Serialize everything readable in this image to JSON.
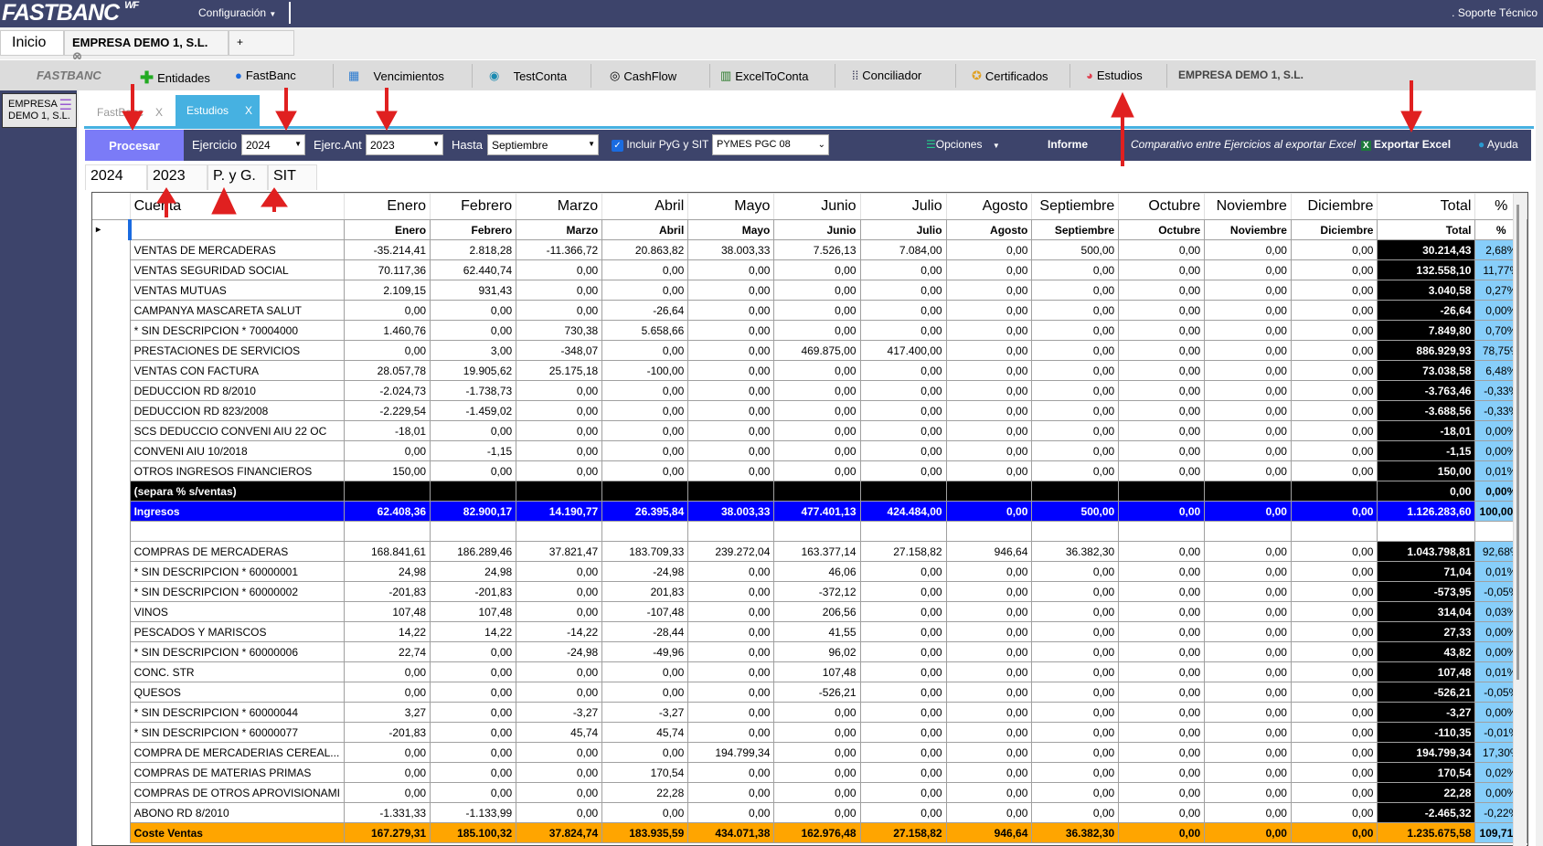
{
  "topbar": {
    "logo": "FASTBANC",
    "logo_sup": "WF",
    "config": "Configuración",
    "soporte": ". Soporte Técnico"
  },
  "tabs": {
    "inicio": "Inicio",
    "empresa": "EMPRESA DEMO 1, S.L.",
    "plus": "+"
  },
  "toolbar": {
    "brand": "FASTBANC",
    "items": [
      "Entidades",
      "FastBanc",
      "Vencimientos",
      "TestConta",
      "CashFlow",
      "ExcelToConta",
      "Conciliador",
      "Certificados",
      "Estudios"
    ],
    "company": "EMPRESA DEMO 1, S.L."
  },
  "side": {
    "company": "EMPRESA DEMO 1, S.L."
  },
  "subtabs": [
    {
      "label": "FastBanc",
      "close": "X"
    },
    {
      "label": "Estudios",
      "close": "X"
    }
  ],
  "filters": {
    "procesar": "Procesar",
    "ejercicio_label": "Ejercicio",
    "ejercicio": "2024",
    "ejerc_ant_label": "Ejerc.Ant",
    "ejerc_ant": "2023",
    "hasta_label": "Hasta",
    "hasta": "Septiembre",
    "incluir": "Incluir PyG y SIT",
    "incluir_checked": true,
    "plan": "PYMES PGC 08",
    "opciones": "Opciones",
    "informe": "Informe",
    "comparativo": "Comparativo entre Ejercicios al exportar Excel",
    "exportar": "Exportar Excel",
    "ayuda": "Ayuda"
  },
  "yeartabs": [
    "2024",
    "2023",
    "P. y G.",
    "SIT"
  ],
  "colors": {
    "header": "#3d446b",
    "accent": "#46b1e1",
    "procesar": "#7b7bf7",
    "ingresos": "#0000ff",
    "coste": "#ffa500",
    "pct": "#87cefa",
    "annotation_arrow": "#e02020"
  },
  "table": {
    "headers": [
      "Cuenta",
      "Enero",
      "Febrero",
      "Marzo",
      "Abril",
      "Mayo",
      "Junio",
      "Julio",
      "Agosto",
      "Septiembre",
      "Octubre",
      "Noviembre",
      "Diciembre",
      "Total",
      "%"
    ],
    "subheaders": [
      "",
      "Enero",
      "Febrero",
      "Marzo",
      "Abril",
      "Mayo",
      "Junio",
      "Julio",
      "Agosto",
      "Septiembre",
      "Octubre",
      "Noviembre",
      "Diciembre",
      "Total",
      "%"
    ],
    "rows": [
      {
        "type": "normal",
        "cells": [
          "VENTAS DE MERCADERAS",
          "-35.214,41",
          "2.818,28",
          "-11.366,72",
          "20.863,82",
          "38.003,33",
          "7.526,13",
          "7.084,00",
          "0,00",
          "500,00",
          "0,00",
          "0,00",
          "0,00",
          "30.214,43",
          "2,68%"
        ]
      },
      {
        "type": "normal",
        "cells": [
          "VENTAS SEGURIDAD SOCIAL",
          "70.117,36",
          "62.440,74",
          "0,00",
          "0,00",
          "0,00",
          "0,00",
          "0,00",
          "0,00",
          "0,00",
          "0,00",
          "0,00",
          "0,00",
          "132.558,10",
          "11,77%"
        ]
      },
      {
        "type": "normal",
        "cells": [
          "VENTAS MUTUAS",
          "2.109,15",
          "931,43",
          "0,00",
          "0,00",
          "0,00",
          "0,00",
          "0,00",
          "0,00",
          "0,00",
          "0,00",
          "0,00",
          "0,00",
          "3.040,58",
          "0,27%"
        ]
      },
      {
        "type": "normal",
        "cells": [
          "CAMPANYA MASCARETA SALUT",
          "0,00",
          "0,00",
          "0,00",
          "-26,64",
          "0,00",
          "0,00",
          "0,00",
          "0,00",
          "0,00",
          "0,00",
          "0,00",
          "0,00",
          "-26,64",
          "0,00%"
        ]
      },
      {
        "type": "normal",
        "cells": [
          "* SIN DESCRIPCION *  70004000",
          "1.460,76",
          "0,00",
          "730,38",
          "5.658,66",
          "0,00",
          "0,00",
          "0,00",
          "0,00",
          "0,00",
          "0,00",
          "0,00",
          "0,00",
          "7.849,80",
          "0,70%"
        ]
      },
      {
        "type": "normal",
        "cells": [
          "PRESTACIONES DE SERVICIOS",
          "0,00",
          "3,00",
          "-348,07",
          "0,00",
          "0,00",
          "469.875,00",
          "417.400,00",
          "0,00",
          "0,00",
          "0,00",
          "0,00",
          "0,00",
          "886.929,93",
          "78,75%"
        ]
      },
      {
        "type": "normal",
        "cells": [
          "VENTAS CON FACTURA",
          "28.057,78",
          "19.905,62",
          "25.175,18",
          "-100,00",
          "0,00",
          "0,00",
          "0,00",
          "0,00",
          "0,00",
          "0,00",
          "0,00",
          "0,00",
          "73.038,58",
          "6,48%"
        ]
      },
      {
        "type": "normal",
        "cells": [
          "DEDUCCION RD 8/2010",
          "-2.024,73",
          "-1.738,73",
          "0,00",
          "0,00",
          "0,00",
          "0,00",
          "0,00",
          "0,00",
          "0,00",
          "0,00",
          "0,00",
          "0,00",
          "-3.763,46",
          "-0,33%"
        ]
      },
      {
        "type": "normal",
        "cells": [
          "DEDUCCION RD 823/2008",
          "-2.229,54",
          "-1.459,02",
          "0,00",
          "0,00",
          "0,00",
          "0,00",
          "0,00",
          "0,00",
          "0,00",
          "0,00",
          "0,00",
          "0,00",
          "-3.688,56",
          "-0,33%"
        ]
      },
      {
        "type": "normal",
        "cells": [
          "SCS DEDUCCIO CONVENI AIU 22 OC",
          "-18,01",
          "0,00",
          "0,00",
          "0,00",
          "0,00",
          "0,00",
          "0,00",
          "0,00",
          "0,00",
          "0,00",
          "0,00",
          "0,00",
          "-18,01",
          "0,00%"
        ]
      },
      {
        "type": "normal",
        "cells": [
          "CONVENI AIU 10/2018",
          "0,00",
          "-1,15",
          "0,00",
          "0,00",
          "0,00",
          "0,00",
          "0,00",
          "0,00",
          "0,00",
          "0,00",
          "0,00",
          "0,00",
          "-1,15",
          "0,00%"
        ]
      },
      {
        "type": "normal",
        "cells": [
          "OTROS INGRESOS FINANCIEROS",
          "150,00",
          "0,00",
          "0,00",
          "0,00",
          "0,00",
          "0,00",
          "0,00",
          "0,00",
          "0,00",
          "0,00",
          "0,00",
          "0,00",
          "150,00",
          "0,01%"
        ]
      },
      {
        "type": "sep",
        "cells": [
          "(separa % s/ventas)",
          "",
          "",
          "",
          "",
          "",
          "",
          "",
          "",
          "",
          "",
          "",
          "",
          "0,00",
          "0,00%"
        ]
      },
      {
        "type": "ing",
        "cells": [
          "Ingresos",
          "62.408,36",
          "82.900,17",
          "14.190,77",
          "26.395,84",
          "38.003,33",
          "477.401,13",
          "424.484,00",
          "0,00",
          "500,00",
          "0,00",
          "0,00",
          "0,00",
          "1.126.283,60",
          "100,00%"
        ]
      },
      {
        "type": "empty",
        "cells": [
          "",
          "",
          "",
          "",
          "",
          "",
          "",
          "",
          "",
          "",
          "",
          "",
          "",
          "",
          ""
        ]
      },
      {
        "type": "normal",
        "cells": [
          "COMPRAS DE MERCADERAS",
          "168.841,61",
          "186.289,46",
          "37.821,47",
          "183.709,33",
          "239.272,04",
          "163.377,14",
          "27.158,82",
          "946,64",
          "36.382,30",
          "0,00",
          "0,00",
          "0,00",
          "1.043.798,81",
          "92,68%"
        ]
      },
      {
        "type": "normal",
        "cells": [
          "* SIN DESCRIPCION *  60000001",
          "24,98",
          "24,98",
          "0,00",
          "-24,98",
          "0,00",
          "46,06",
          "0,00",
          "0,00",
          "0,00",
          "0,00",
          "0,00",
          "0,00",
          "71,04",
          "0,01%"
        ]
      },
      {
        "type": "normal",
        "cells": [
          "* SIN DESCRIPCION *  60000002",
          "-201,83",
          "-201,83",
          "0,00",
          "201,83",
          "0,00",
          "-372,12",
          "0,00",
          "0,00",
          "0,00",
          "0,00",
          "0,00",
          "0,00",
          "-573,95",
          "-0,05%"
        ]
      },
      {
        "type": "normal",
        "cells": [
          "VINOS",
          "107,48",
          "107,48",
          "0,00",
          "-107,48",
          "0,00",
          "206,56",
          "0,00",
          "0,00",
          "0,00",
          "0,00",
          "0,00",
          "0,00",
          "314,04",
          "0,03%"
        ]
      },
      {
        "type": "normal",
        "cells": [
          "PESCADOS Y MARISCOS",
          "14,22",
          "14,22",
          "-14,22",
          "-28,44",
          "0,00",
          "41,55",
          "0,00",
          "0,00",
          "0,00",
          "0,00",
          "0,00",
          "0,00",
          "27,33",
          "0,00%"
        ]
      },
      {
        "type": "normal",
        "cells": [
          "* SIN DESCRIPCION *  60000006",
          "22,74",
          "0,00",
          "-24,98",
          "-49,96",
          "0,00",
          "96,02",
          "0,00",
          "0,00",
          "0,00",
          "0,00",
          "0,00",
          "0,00",
          "43,82",
          "0,00%"
        ]
      },
      {
        "type": "normal",
        "cells": [
          "CONC. STR",
          "0,00",
          "0,00",
          "0,00",
          "0,00",
          "0,00",
          "107,48",
          "0,00",
          "0,00",
          "0,00",
          "0,00",
          "0,00",
          "0,00",
          "107,48",
          "0,01%"
        ]
      },
      {
        "type": "normal",
        "cells": [
          "QUESOS",
          "0,00",
          "0,00",
          "0,00",
          "0,00",
          "0,00",
          "-526,21",
          "0,00",
          "0,00",
          "0,00",
          "0,00",
          "0,00",
          "0,00",
          "-526,21",
          "-0,05%"
        ]
      },
      {
        "type": "normal",
        "cells": [
          "* SIN DESCRIPCION *  60000044",
          "3,27",
          "0,00",
          "-3,27",
          "-3,27",
          "0,00",
          "0,00",
          "0,00",
          "0,00",
          "0,00",
          "0,00",
          "0,00",
          "0,00",
          "-3,27",
          "0,00%"
        ]
      },
      {
        "type": "normal",
        "cells": [
          "* SIN DESCRIPCION *  60000077",
          "-201,83",
          "0,00",
          "45,74",
          "45,74",
          "0,00",
          "0,00",
          "0,00",
          "0,00",
          "0,00",
          "0,00",
          "0,00",
          "0,00",
          "-110,35",
          "-0,01%"
        ]
      },
      {
        "type": "normal",
        "cells": [
          "COMPRA DE MERCADERIAS CEREAL...",
          "0,00",
          "0,00",
          "0,00",
          "0,00",
          "194.799,34",
          "0,00",
          "0,00",
          "0,00",
          "0,00",
          "0,00",
          "0,00",
          "0,00",
          "194.799,34",
          "17,30%"
        ]
      },
      {
        "type": "normal",
        "cells": [
          "COMPRAS DE MATERIAS PRIMAS",
          "0,00",
          "0,00",
          "0,00",
          "170,54",
          "0,00",
          "0,00",
          "0,00",
          "0,00",
          "0,00",
          "0,00",
          "0,00",
          "0,00",
          "170,54",
          "0,02%"
        ]
      },
      {
        "type": "normal",
        "cells": [
          "COMPRAS DE OTROS APROVISIONAMI",
          "0,00",
          "0,00",
          "0,00",
          "22,28",
          "0,00",
          "0,00",
          "0,00",
          "0,00",
          "0,00",
          "0,00",
          "0,00",
          "0,00",
          "22,28",
          "0,00%"
        ]
      },
      {
        "type": "normal",
        "cells": [
          "ABONO RD 8/2010",
          "-1.331,33",
          "-1.133,99",
          "0,00",
          "0,00",
          "0,00",
          "0,00",
          "0,00",
          "0,00",
          "0,00",
          "0,00",
          "0,00",
          "0,00",
          "-2.465,32",
          "-0,22%"
        ]
      },
      {
        "type": "cost",
        "cells": [
          "Coste Ventas",
          "167.279,31",
          "185.100,32",
          "37.824,74",
          "183.935,59",
          "434.071,38",
          "162.976,48",
          "27.158,82",
          "946,64",
          "36.382,30",
          "0,00",
          "0,00",
          "0,00",
          "1.235.675,58",
          "109,71%"
        ]
      }
    ]
  }
}
